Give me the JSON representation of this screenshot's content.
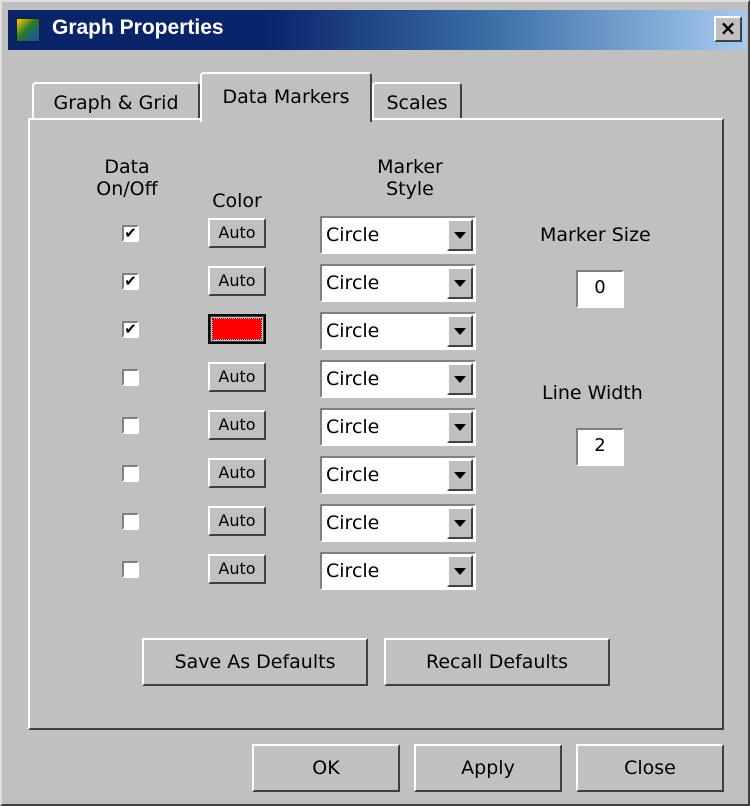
{
  "window": {
    "title": "Graph Properties",
    "close_glyph": "×",
    "icon": "app-graph-icon"
  },
  "tabs": [
    {
      "label": "Graph & Grid",
      "active": false
    },
    {
      "label": "Data Markers",
      "active": true
    },
    {
      "label": "Scales",
      "active": false
    }
  ],
  "headers": {
    "data_onoff_line1": "Data",
    "data_onoff_line2": "On/Off",
    "color": "Color",
    "marker_style_line1": "Marker",
    "marker_style_line2": "Style"
  },
  "rows": [
    {
      "checked": "✔",
      "color_label": "Auto",
      "marker": "Circle"
    },
    {
      "checked": "✔",
      "color_label": "Auto",
      "marker": "Circle"
    },
    {
      "checked": "✔",
      "color_label": "",
      "color_hex": "#ff0000",
      "marker": "Circle"
    },
    {
      "checked": "",
      "color_label": "Auto",
      "marker": "Circle"
    },
    {
      "checked": "",
      "color_label": "Auto",
      "marker": "Circle"
    },
    {
      "checked": "",
      "color_label": "Auto",
      "marker": "Circle"
    },
    {
      "checked": "",
      "color_label": "Auto",
      "marker": "Circle"
    },
    {
      "checked": "",
      "color_label": "Auto",
      "marker": "Circle"
    }
  ],
  "marker_size": {
    "label": "Marker Size",
    "value": "0"
  },
  "line_width": {
    "label": "Line Width",
    "value": "2"
  },
  "buttons": {
    "save_defaults": "Save As Defaults",
    "recall_defaults": "Recall Defaults",
    "ok": "OK",
    "apply": "Apply",
    "close": "Close"
  }
}
